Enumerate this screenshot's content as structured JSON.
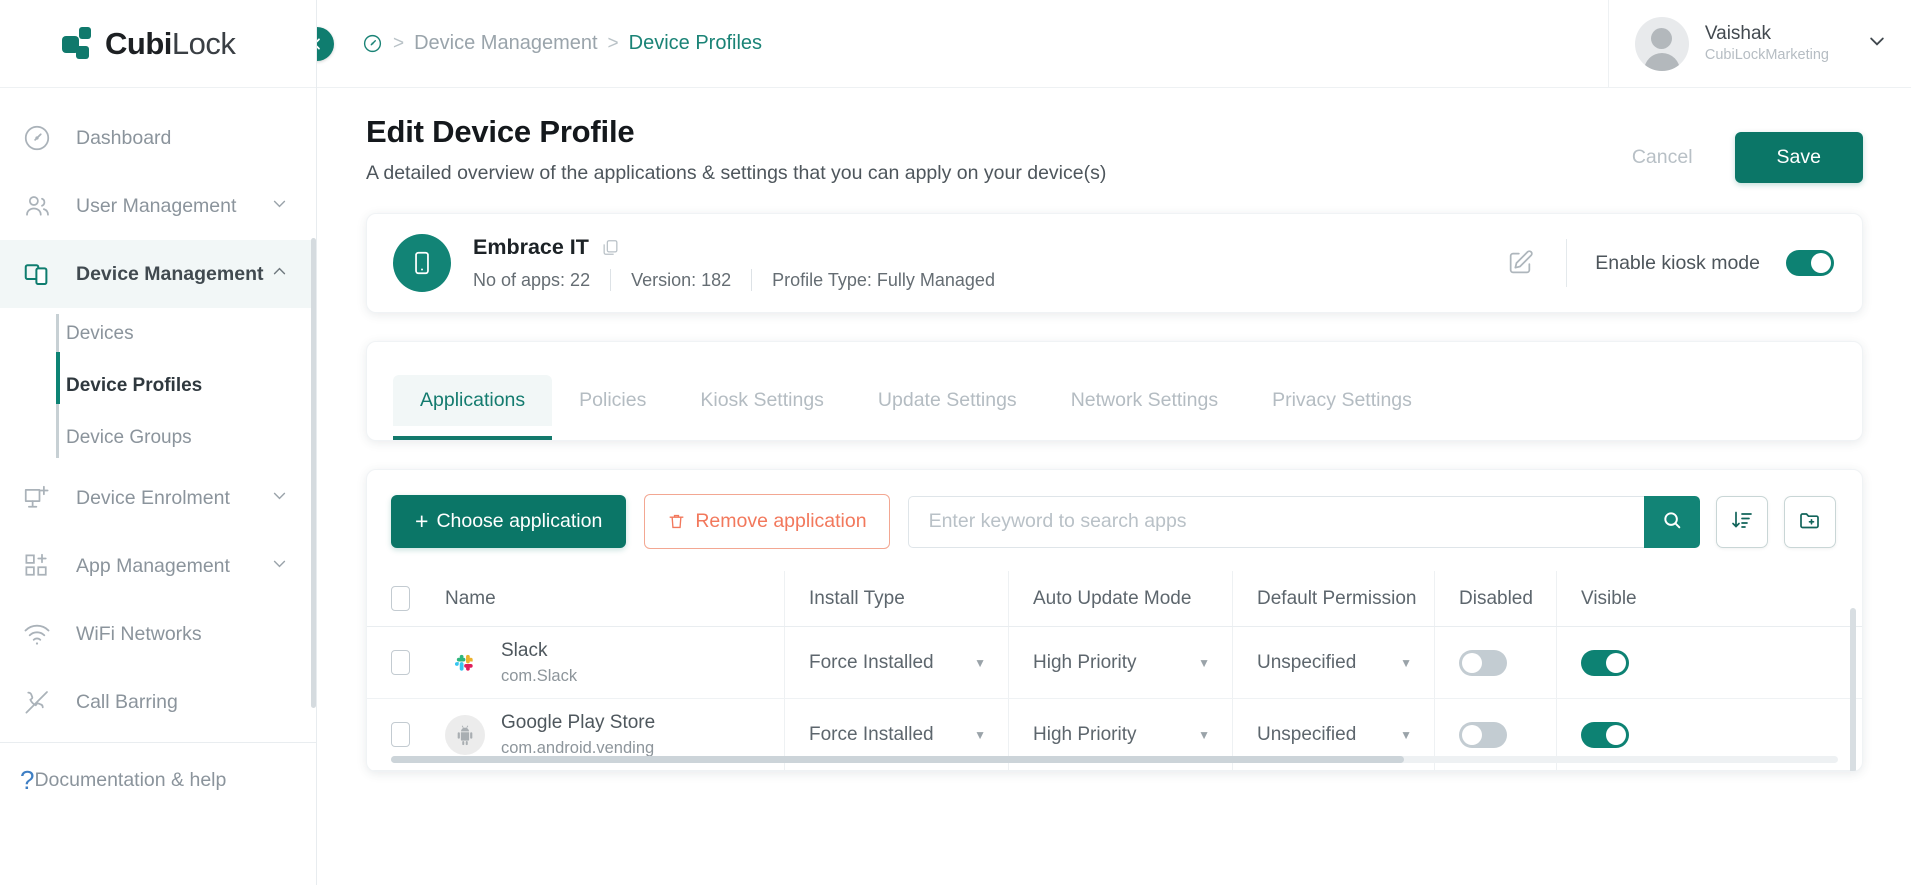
{
  "brand": {
    "name_bold": "Cubi",
    "name_light": "Lock",
    "accent": "#0d8273",
    "accent_dark": "#0b7667"
  },
  "sidebar": {
    "items": [
      {
        "label": "Dashboard",
        "icon": "speedometer-icon",
        "active": false,
        "expandable": false
      },
      {
        "label": "User Management",
        "icon": "users-icon",
        "active": false,
        "expandable": true
      },
      {
        "label": "Device Management",
        "icon": "devices-icon",
        "active": true,
        "expandable": true
      }
    ],
    "sub_items": [
      {
        "label": "Devices",
        "active": false
      },
      {
        "label": "Device Profiles",
        "active": true
      },
      {
        "label": "Device Groups",
        "active": false
      }
    ],
    "items_after": [
      {
        "label": "Device Enrolment",
        "icon": "monitor-plus-icon",
        "expandable": true
      },
      {
        "label": "App Management",
        "icon": "grid-plus-icon",
        "expandable": true
      },
      {
        "label": "WiFi Networks",
        "icon": "wifi-icon",
        "expandable": false
      },
      {
        "label": "Call Barring",
        "icon": "call-barring-icon",
        "expandable": false
      }
    ],
    "help": {
      "label": "Documentation & help",
      "icon": "question-mark-icon"
    }
  },
  "topbar": {
    "collapse_icon": "chevron-left-icon",
    "breadcrumb": {
      "home_icon": "dashboard-icon",
      "separator": ">",
      "parent": "Device Management",
      "current": "Device Profiles"
    },
    "user": {
      "name": "Vaishak",
      "org": "CubiLockMarketing",
      "avatar_icon": "avatar-icon",
      "chevron_icon": "chevron-down-icon"
    }
  },
  "page": {
    "title": "Edit Device Profile",
    "subtitle": "A detailed overview of the applications & settings that you can apply on your device(s)",
    "cancel_label": "Cancel",
    "save_label": "Save"
  },
  "profile": {
    "icon": "mobile-phone-icon",
    "name": "Embrace IT",
    "copy_icon": "copy-icon",
    "apps_count": "No of apps: 22",
    "version": "Version: 182",
    "profile_type": "Profile Type: Fully Managed",
    "edit_icon": "edit-pencil-icon",
    "kiosk_label": "Enable kiosk mode",
    "kiosk_enabled": true
  },
  "tabs": [
    {
      "label": "Applications",
      "active": true
    },
    {
      "label": "Policies",
      "active": false
    },
    {
      "label": "Kiosk Settings",
      "active": false
    },
    {
      "label": "Update Settings",
      "active": false
    },
    {
      "label": "Network Settings",
      "active": false
    },
    {
      "label": "Privacy Settings",
      "active": false
    }
  ],
  "toolbar": {
    "choose_label": "Choose application",
    "choose_plus": "+",
    "remove_label": "Remove application",
    "remove_icon": "trash-icon",
    "search_placeholder": "Enter keyword to search apps",
    "search_value": "",
    "search_icon": "search-icon",
    "sort_icon": "sort-descending-icon",
    "folder_icon": "folder-plus-icon"
  },
  "table": {
    "columns": [
      "Name",
      "Install Type",
      "Auto Update Mode",
      "Default Permission",
      "Disabled",
      "Visible"
    ],
    "rows": [
      {
        "app_name": "Slack",
        "package": "com.Slack",
        "icon": "slack-icon",
        "install_type": "Force Installed",
        "auto_update": "High Priority",
        "default_permission": "Unspecified",
        "disabled": false,
        "visible": true
      },
      {
        "app_name": "Google Play Store",
        "package": "com.android.vending",
        "icon": "android-icon",
        "install_type": "Force Installed",
        "auto_update": "High Priority",
        "default_permission": "Unspecified",
        "disabled": false,
        "visible": true
      }
    ]
  }
}
